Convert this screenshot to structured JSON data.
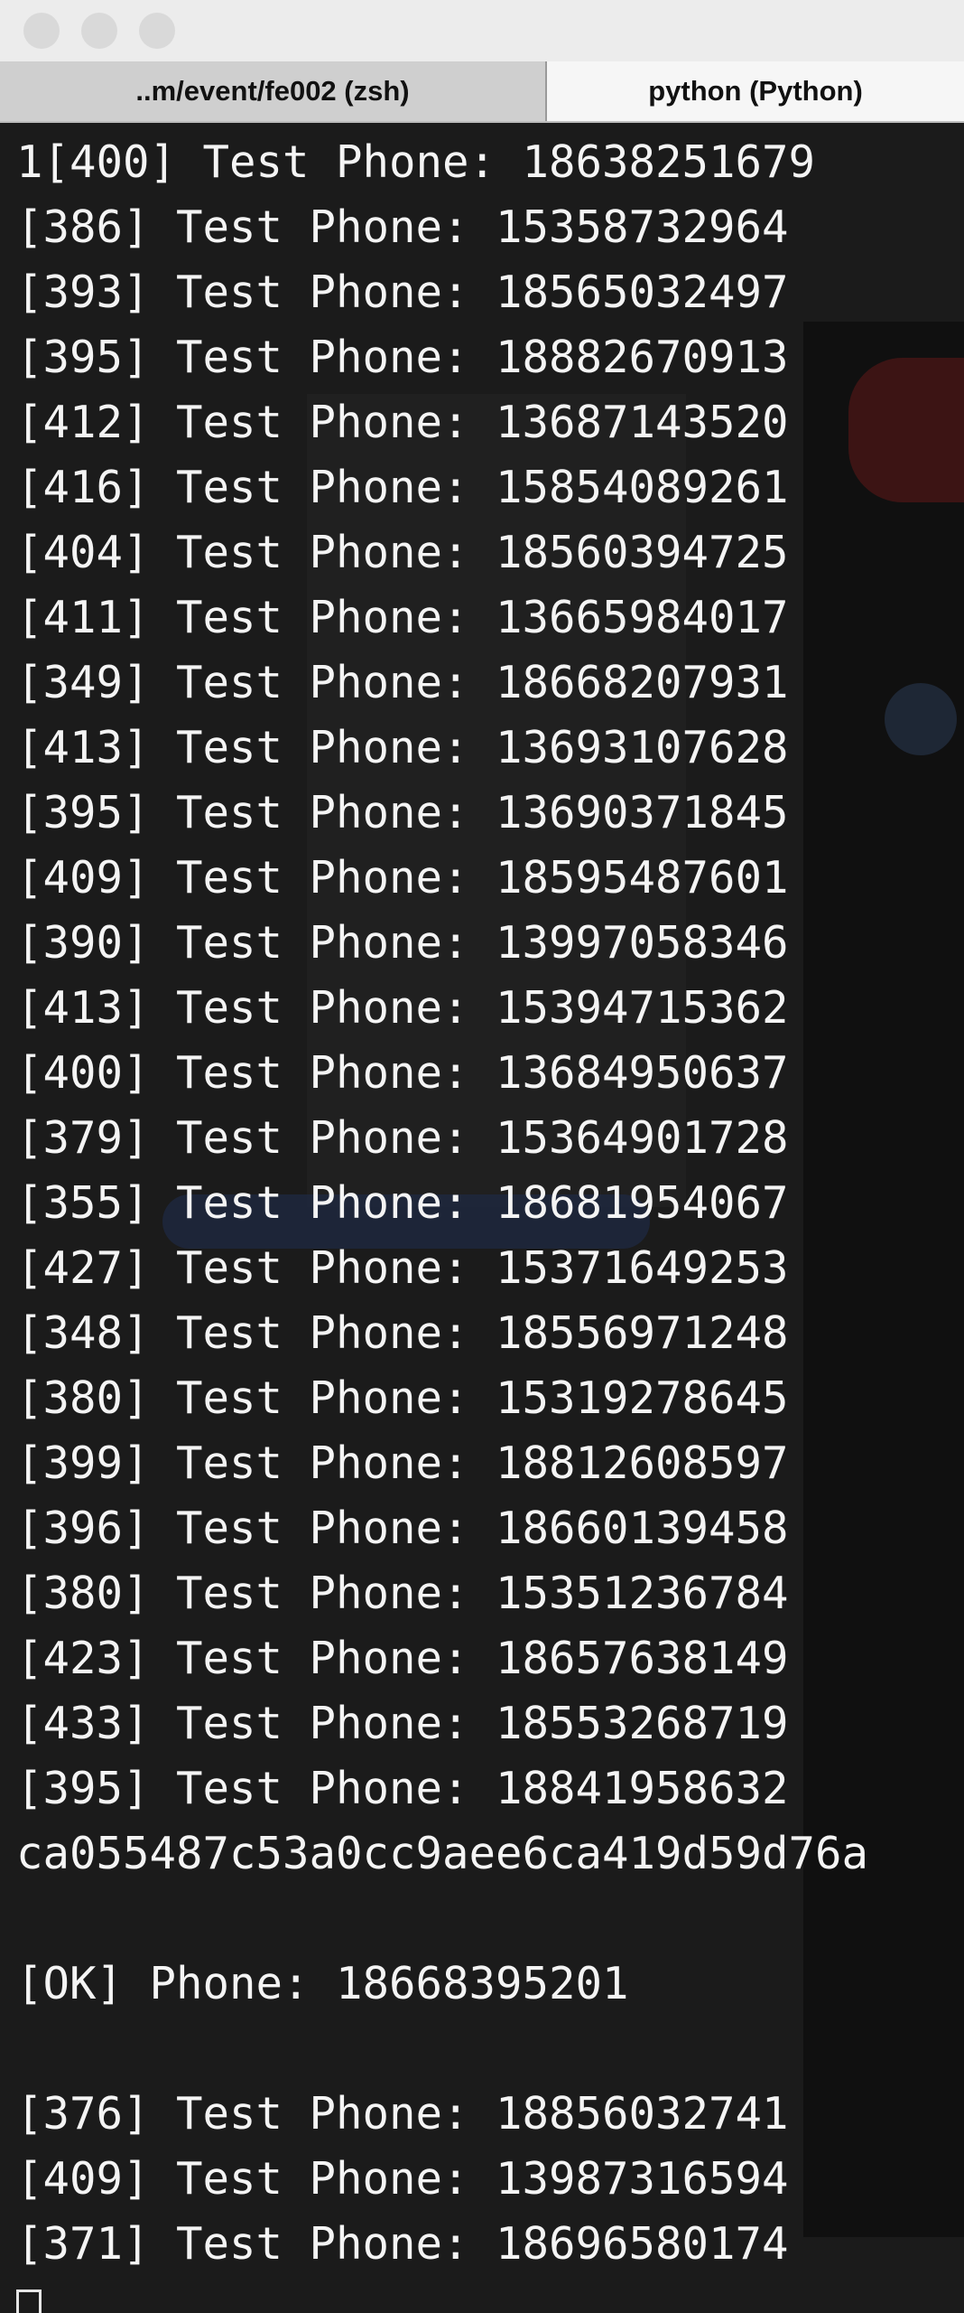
{
  "window": {
    "tabs": [
      {
        "label": "..m/event/fe002 (zsh)",
        "active": false
      },
      {
        "label": "python (Python)",
        "active": true
      }
    ]
  },
  "terminal": {
    "lines": [
      "1[400] Test Phone: 18638251679",
      "[386] Test Phone: 15358732964",
      "[393] Test Phone: 18565032497",
      "[395] Test Phone: 18882670913",
      "[412] Test Phone: 13687143520",
      "[416] Test Phone: 15854089261",
      "[404] Test Phone: 18560394725",
      "[411] Test Phone: 13665984017",
      "[349] Test Phone: 18668207931",
      "[413] Test Phone: 13693107628",
      "[395] Test Phone: 13690371845",
      "[409] Test Phone: 18595487601",
      "[390] Test Phone: 13997058346",
      "[413] Test Phone: 15394715362",
      "[400] Test Phone: 13684950637",
      "[379] Test Phone: 15364901728",
      "[355] Test Phone: 18681954067",
      "[427] Test Phone: 15371649253",
      "[348] Test Phone: 18556971248",
      "[380] Test Phone: 15319278645",
      "[399] Test Phone: 18812608597",
      "[396] Test Phone: 18660139458",
      "[380] Test Phone: 15351236784",
      "[423] Test Phone: 18657638149",
      "[433] Test Phone: 18553268719",
      "[395] Test Phone: 18841958632",
      "ca055487c53a0cc9aee6ca419d59d76a",
      "",
      "[OK] Phone: 18668395201",
      "",
      "[376] Test Phone: 18856032741",
      "[409] Test Phone: 13987316594",
      "[371] Test Phone: 18696580174"
    ]
  },
  "colors": {
    "terminal_bg": "#1b1b1b",
    "terminal_text": "#f4f4f4",
    "titlebar_bg": "#ececec"
  }
}
